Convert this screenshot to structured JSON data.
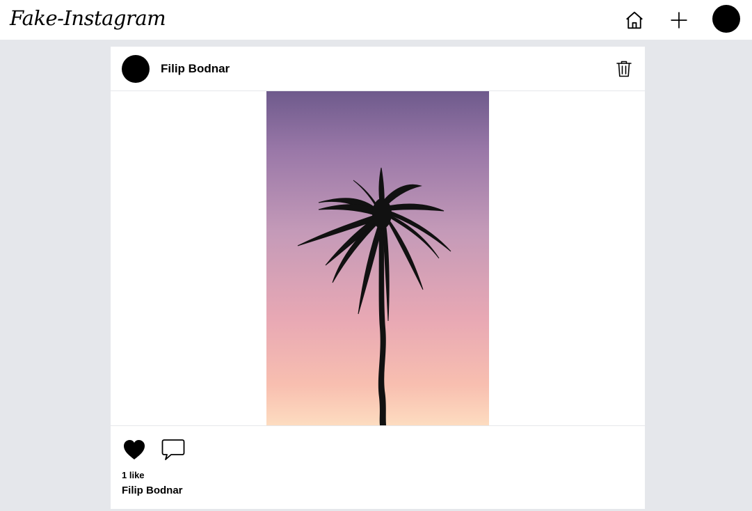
{
  "app": {
    "logo": "Fake-Instagram"
  },
  "nav": {
    "icons": [
      "home-icon",
      "plus-icon",
      "user-avatar"
    ]
  },
  "post": {
    "author": "Filip Bodnar",
    "image_alt": "Palm tree silhouette against a purple-pink sunset sky",
    "likes_text": "1 like",
    "caption_author": "Filip Bodnar",
    "icons": [
      "trash-icon",
      "heart-icon",
      "comment-icon"
    ]
  },
  "colors": {
    "page_background": "#e5e7eb",
    "card_background": "#ffffff",
    "divider": "#e5e7eb",
    "text": "#000000"
  }
}
